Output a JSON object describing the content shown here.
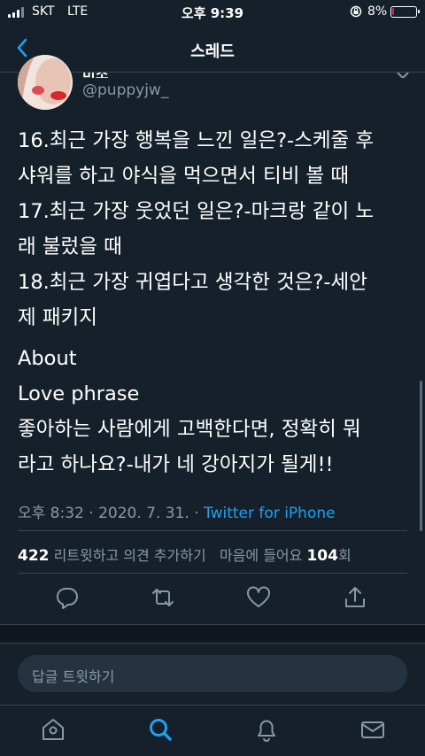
{
  "status_bar": {
    "carrier": "SKT",
    "network": "LTE",
    "time": "오후 9:39",
    "battery_percent": "8%",
    "battery_level": 0.08,
    "battery_color": "#e0245e"
  },
  "header": {
    "title": "스레드",
    "back_icon": "chevron-left-icon"
  },
  "author": {
    "display_name": "미조",
    "handle": "@puppyjw_"
  },
  "tweet": {
    "lines": [
      "16.최근 가장 행복을 느낀 일은?-스케줄 후",
      "샤워를 하고 야식을 먹으면서 티비 볼 때",
      "17.최근 가장 웃었던 일은?-마크랑 같이 노",
      "래 불렀을 때",
      "18.최근 가장 귀엽다고 생각한 것은?-세안",
      "제 패키지",
      "About",
      "Love phrase",
      "좋아하는 사람에게 고백한다면, 정확히 뭐",
      "라고 하나요?-내가 네 강아지가 될게!!"
    ]
  },
  "meta": {
    "time": "오후 8:32",
    "date": "2020. 7. 31.",
    "separator": "·",
    "source": "Twitter for iPhone"
  },
  "stats": {
    "retweets_count": "422",
    "retweets_label": "리트윗하고 의견 추가하기",
    "likes_prefix": "마음에 들어요",
    "likes_count": "104",
    "likes_suffix": "회"
  },
  "actions": [
    "reply-icon",
    "retweet-icon",
    "heart-icon",
    "share-icon"
  ],
  "reply": {
    "placeholder": "답글 트윗하기"
  },
  "tabs": [
    "home-icon",
    "search-icon",
    "notifications-icon",
    "messages-icon"
  ],
  "colors": {
    "background": "#15202b",
    "accent": "#1da1f2",
    "secondary_text": "#8899a6",
    "border": "#38444d"
  }
}
